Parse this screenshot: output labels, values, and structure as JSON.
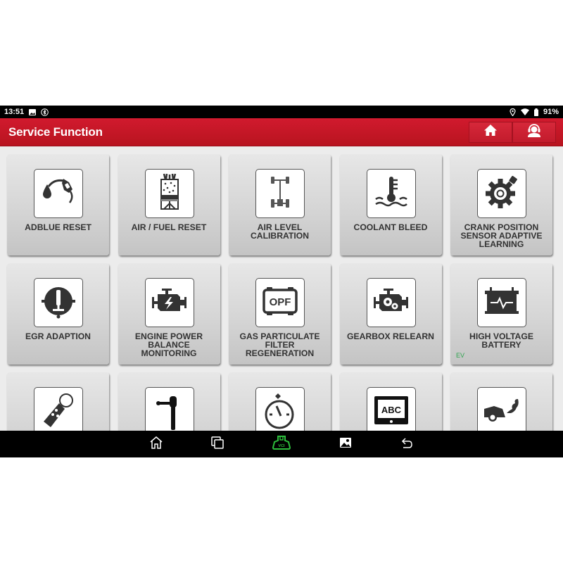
{
  "status_bar": {
    "time": "13:51",
    "left_icons": [
      "image-notification-icon",
      "bluetooth-icon"
    ],
    "right_icons": [
      "location-icon",
      "wifi-icon",
      "battery-icon"
    ],
    "battery": "91%"
  },
  "app_bar": {
    "title": "Service Function",
    "actions": [
      "home-icon",
      "support-headset-icon"
    ]
  },
  "tiles": [
    {
      "label": "ADBLUE RESET",
      "icon": "adblue-pump-icon"
    },
    {
      "label": "AIR / FUEL RESET",
      "icon": "air-fuel-cylinder-icon"
    },
    {
      "label": "AIR LEVEL CALIBRATION",
      "icon": "chassis-axle-icon"
    },
    {
      "label": "COOLANT BLEED",
      "icon": "coolant-temperature-icon"
    },
    {
      "label": "CRANK POSITION SENSOR ADAPTIVE LEARNING",
      "icon": "crank-gear-sensor-icon"
    },
    {
      "label": "EGR ADAPTION",
      "icon": "egr-valve-icon"
    },
    {
      "label": "ENGINE POWER BALANCE MONITORING",
      "icon": "engine-lightning-icon"
    },
    {
      "label": "GAS PARTICULATE FILTER REGENERATION",
      "icon": "opf-filter-icon"
    },
    {
      "label": "GEARBOX RELEARN",
      "icon": "engine-gears-icon"
    },
    {
      "label": "HIGH VOLTAGE BATTERY",
      "icon": "battery-pulse-icon",
      "badge": "EV"
    },
    {
      "label": "",
      "icon": "car-key-fob-icon"
    },
    {
      "label": "",
      "icon": "steering-column-icon"
    },
    {
      "label": "",
      "icon": "stopwatch-icon"
    },
    {
      "label": "",
      "icon": "abc-display-icon"
    },
    {
      "label": "",
      "icon": "car-exhaust-icon"
    }
  ],
  "nav_bar": {
    "buttons": [
      "home-icon",
      "recent-apps-icon",
      "vci-connector-icon",
      "screenshot-gallery-icon",
      "back-icon"
    ],
    "vci_label": "VCI",
    "vci_color": "#2dbe3c"
  },
  "colors": {
    "brand_red": "#c8172a",
    "ev_badge": "#2ea44f",
    "icon_dark": "#333333"
  }
}
